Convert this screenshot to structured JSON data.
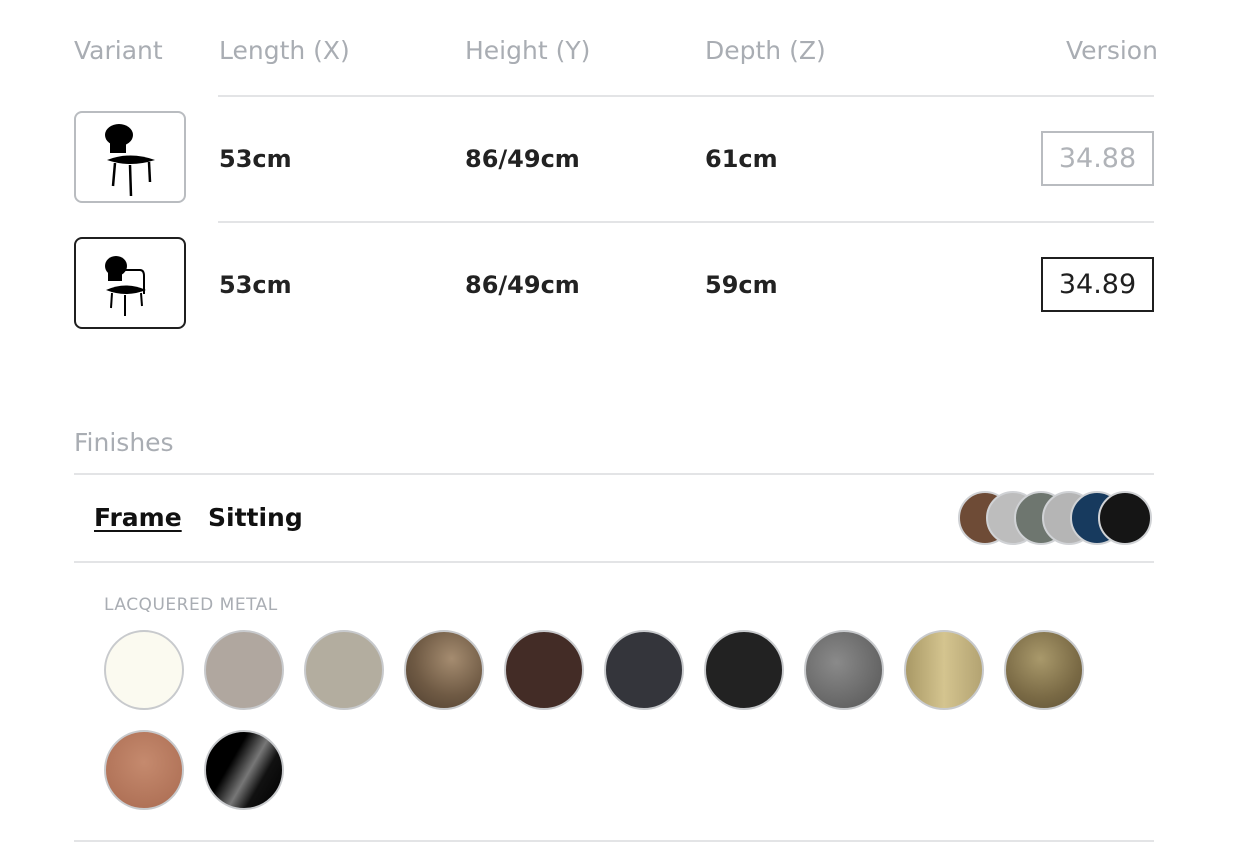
{
  "table": {
    "headers": {
      "variant": "Variant",
      "length": "Length (X)",
      "height": "Height (Y)",
      "depth": "Depth (Z)",
      "version": "Version"
    },
    "rows": [
      {
        "length": "53cm",
        "height": "86/49cm",
        "depth": "61cm",
        "version": "34.88",
        "selected": false,
        "thumbnail_icon": "chair-icon"
      },
      {
        "length": "53cm",
        "height": "86/49cm",
        "depth": "59cm",
        "version": "34.89",
        "selected": true,
        "thumbnail_icon": "armchair-icon"
      }
    ]
  },
  "finishes": {
    "title": "Finishes",
    "tabs": [
      {
        "label": "Frame",
        "active": true
      },
      {
        "label": "Sitting",
        "active": false
      }
    ],
    "preview_colors": [
      "#6e4b36",
      "#bdbdbd",
      "#6e766f",
      "#b5b5b5",
      "#173a5e",
      "#151515"
    ],
    "group_label": "LACQUERED METAL",
    "swatches": [
      "#fbfaf0",
      "#b0a79f",
      "#b3ad9f",
      "#6f5a44",
      "#432c26",
      "#34353b",
      "#222222",
      "#6a6a6a",
      "#c4b37f",
      "#8a7a52",
      "#b7775b",
      "#0c0c0c"
    ]
  }
}
